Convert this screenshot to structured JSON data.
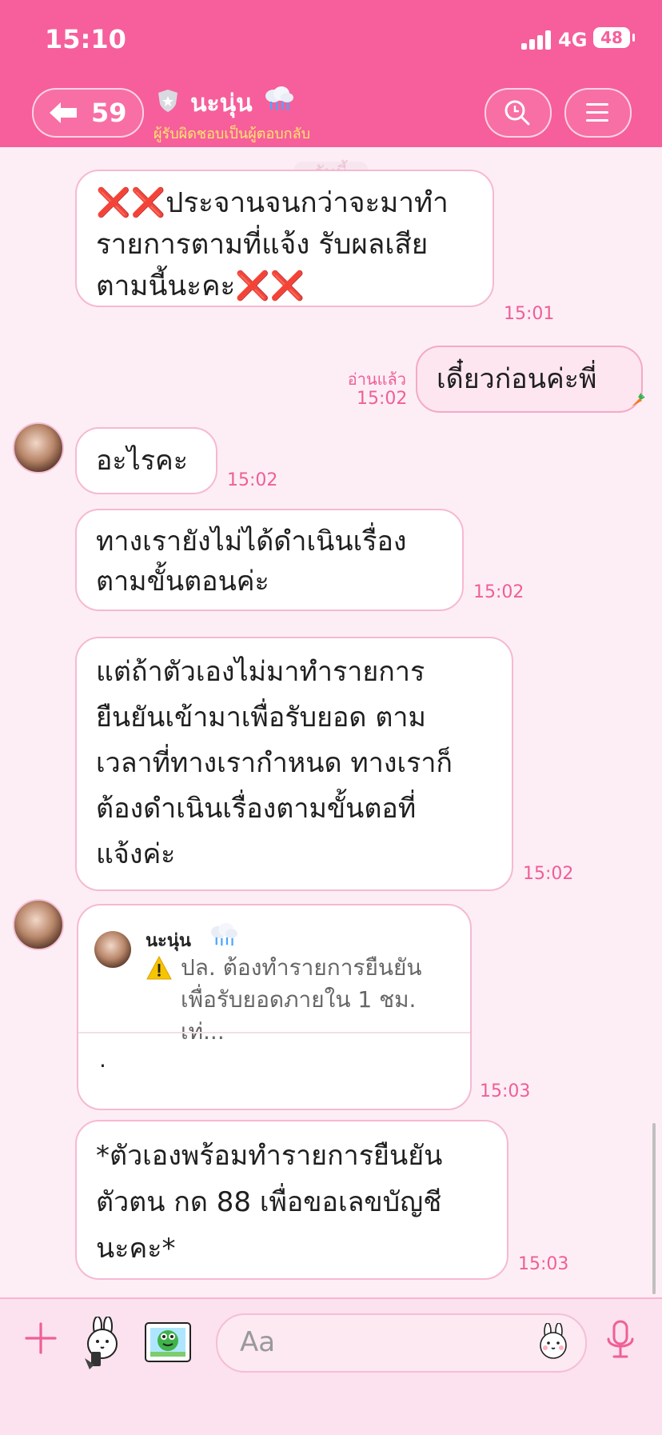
{
  "status_bar": {
    "time": "15:10",
    "network": "4G",
    "battery": "48"
  },
  "header": {
    "back_count": "59",
    "title": "นะนุ่น",
    "subtitle": "ผู้รับผิดชอบเป็นผู้ตอบกลับ",
    "icons": {
      "back": "back-arrow-icon",
      "search": "search-icon",
      "menu": "menu-icon",
      "verified": "shield-icon",
      "cloud": "rain-cloud-icon"
    },
    "brand_color": "#f65f9b"
  },
  "chat": {
    "day_separator": "วันนี้",
    "messages": [
      {
        "text": "❌❌ประจานจนกว่าจะมาทำ\nรายการตามที่แจ้ง รับผลเสีย\nตามนี้นะคะ❌❌",
        "time": "15:01",
        "sender": "other"
      },
      {
        "text": "เดี๋ยวก่อนค่ะพี่",
        "time": "15:02",
        "read_label": "อ่านแล้ว",
        "sender": "me"
      },
      {
        "text": "อะไรคะ",
        "time": "15:02",
        "sender": "other"
      },
      {
        "text": "ทางเรายังไม่ได้ดำเนินเรื่อง\nตามขั้นตอนค่ะ",
        "time": "15:02",
        "sender": "other"
      },
      {
        "text": "แต่ถ้าตัวเองไม่มาทำรายการ\nยืนยันเข้ามาเพื่อรับยอด ตาม\nเวลาที่ทางเรากำหนด ทางเราก็\nต้องดำเนินเรื่องตามขั้นตอที่\nแจ้งค่ะ",
        "time": "15:02",
        "sender": "other"
      },
      {
        "quote": {
          "name": "นะนุ่น",
          "text": "ปล. ต้องทำรายการยืนยัน\nเพื่อรับยอดภายใน 1 ชม. เท่..."
        },
        "text": ".",
        "time": "15:03",
        "sender": "other"
      },
      {
        "text": "*ตัวเองพร้อมทำรายการยืนยัน\nตัวตน กด 88 เพื่อขอเลขบัญชี\nนะคะ*",
        "time": "15:03",
        "sender": "other"
      }
    ]
  },
  "composer": {
    "placeholder": "Aa",
    "icons": {
      "plus": "plus-icon",
      "sticker": "sticker-icon",
      "gallery": "gallery-icon",
      "emoji": "emoji-icon",
      "mic": "microphone-icon"
    }
  }
}
